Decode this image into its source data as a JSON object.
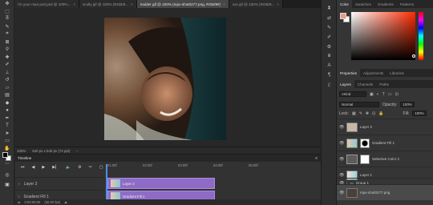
{
  "tabs": [
    {
      "label": "i'm your man psd.psd @ 100%...",
      "active": false
    },
    {
      "label": "scully gif @ 100% (RGB/8...",
      "active": false
    },
    {
      "label": "mulder gif @ 100% (mpv-shot0277.png, RGB/8#)",
      "active": true
    },
    {
      "label": "xxx gif @ 100% (RGB/8...",
      "active": false
    }
  ],
  "status": {
    "zoom": "100%",
    "doc": "540 px x 540 px (72 ppi)"
  },
  "timeline": {
    "title": "Timeline",
    "ruler": [
      "01:00f",
      "02:00f",
      "03:00f",
      "04:00f",
      "05:00f"
    ],
    "tracks": [
      {
        "label": "Layer 2",
        "clip": "Layer 2"
      },
      {
        "label": "Gradient Fill 1",
        "clip": "Gradient Fill 1"
      }
    ],
    "timecode": "0:00:00:00",
    "fps": "(30.00 fps)"
  },
  "color_panel": {
    "tabs": [
      "Color",
      "Swatches",
      "Gradients",
      "Patterns"
    ],
    "fg_color": "#e89b84",
    "bg_color": "#ffffff"
  },
  "properties_tabs": [
    "Properties",
    "Adjustments",
    "Libraries"
  ],
  "layers_panel": {
    "tabs": [
      "Layers",
      "Channels",
      "Paths"
    ],
    "kind": "Kind",
    "blend": "Normal",
    "opacity_label": "Opacity:",
    "opacity": "100%",
    "lock_label": "Lock:",
    "fill_label": "Fill:",
    "fill": "100%",
    "layers": [
      {
        "name": "Layer 2",
        "thumb": "#c9b7a6"
      },
      {
        "name": "Gradient Fill 1",
        "thumb": "#9ed0cf"
      },
      {
        "name": "Selective Color 2",
        "thumb": "#bfbfbf"
      },
      {
        "name": "Layer 1",
        "thumb": "#c9dde0"
      },
      {
        "name": "Group 1",
        "thumb": "folder"
      },
      {
        "name": "mpv-shot0277.png",
        "thumb": "#4b4038"
      }
    ]
  }
}
